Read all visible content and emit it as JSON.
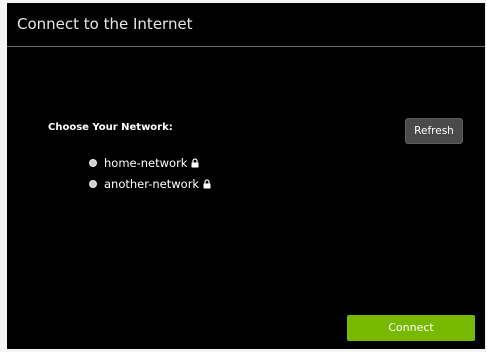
{
  "dialog": {
    "title": "Connect to the Internet"
  },
  "network_section": {
    "label": "Choose Your Network:",
    "refresh_label": "Refresh",
    "networks": [
      {
        "name": "home-network",
        "secured": true,
        "icon": "lock-icon",
        "selected": false
      },
      {
        "name": "another-network",
        "secured": true,
        "icon": "lock-icon",
        "selected": false
      }
    ]
  },
  "footer": {
    "connect_label": "Connect"
  },
  "colors": {
    "background": "#000000",
    "accent": "#76b900",
    "secondary_button": "#4a4a4a",
    "divider": "#6a6a6a"
  }
}
